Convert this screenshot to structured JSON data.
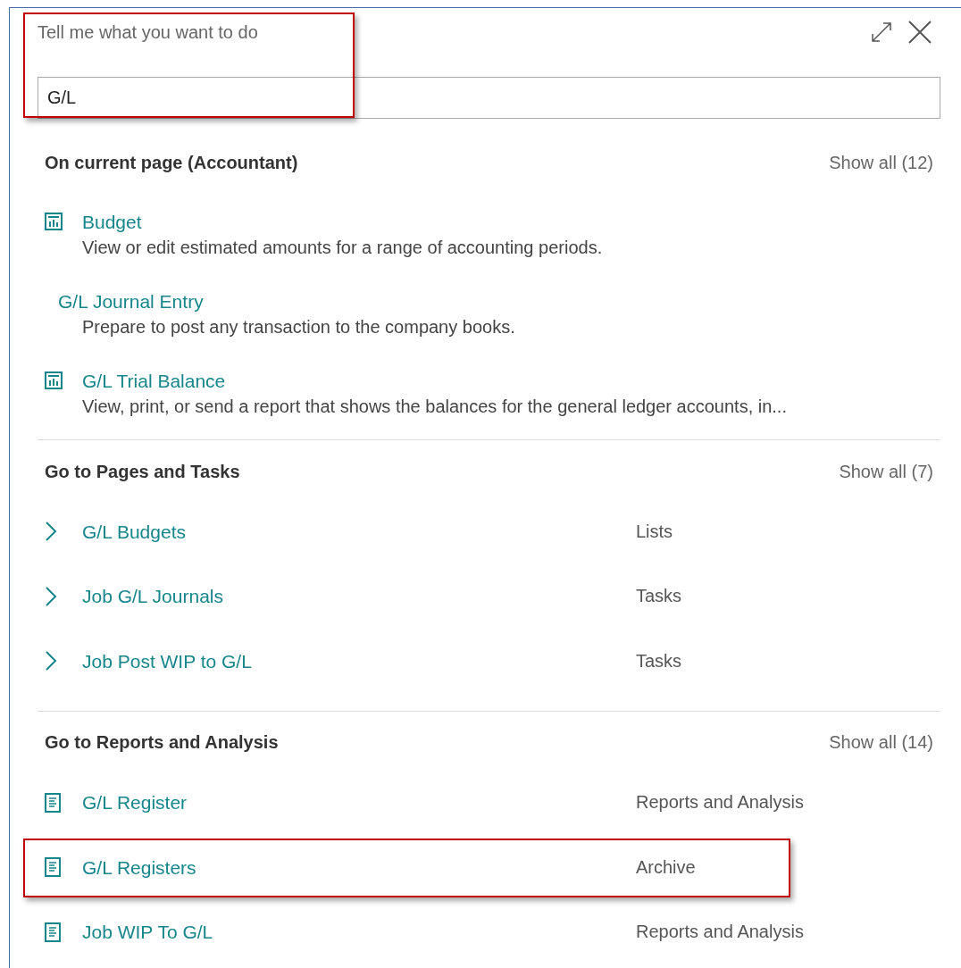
{
  "search": {
    "title": "Tell me what you want to do",
    "value": "G/L",
    "highlighted": true
  },
  "sections": [
    {
      "heading": "On current page (Accountant)",
      "show_all": "Show all (12)",
      "items": [
        {
          "kind": "chart",
          "title": "Budget",
          "description": "View or edit estimated amounts for a range of accounting periods.",
          "highlighted": false
        },
        {
          "kind": "plain",
          "title": "G/L Journal Entry",
          "description": "Prepare to post any transaction to the company books.",
          "highlighted": false
        },
        {
          "kind": "chart",
          "title": "G/L Trial Balance",
          "description": "View, print, or send a report that shows the balances for the general ledger accounts, in...",
          "highlighted": false
        }
      ]
    },
    {
      "heading": "Go to Pages and Tasks",
      "show_all": "Show all (7)",
      "items": [
        {
          "kind": "page",
          "title": "G/L Budgets",
          "category": "Lists",
          "highlighted": false
        },
        {
          "kind": "page",
          "title": "Job G/L Journals",
          "category": "Tasks",
          "highlighted": false
        },
        {
          "kind": "page",
          "title": "Job Post WIP to G/L",
          "category": "Tasks",
          "highlighted": false
        }
      ]
    },
    {
      "heading": "Go to Reports and Analysis",
      "show_all": "Show all (14)",
      "items": [
        {
          "kind": "report",
          "title": "G/L Register",
          "category": "Reports and Analysis",
          "highlighted": false
        },
        {
          "kind": "report",
          "title": "G/L Registers",
          "category": "Archive",
          "highlighted": true
        },
        {
          "kind": "report",
          "title": "Job WIP To G/L",
          "category": "Reports and Analysis",
          "highlighted": false
        }
      ]
    }
  ]
}
